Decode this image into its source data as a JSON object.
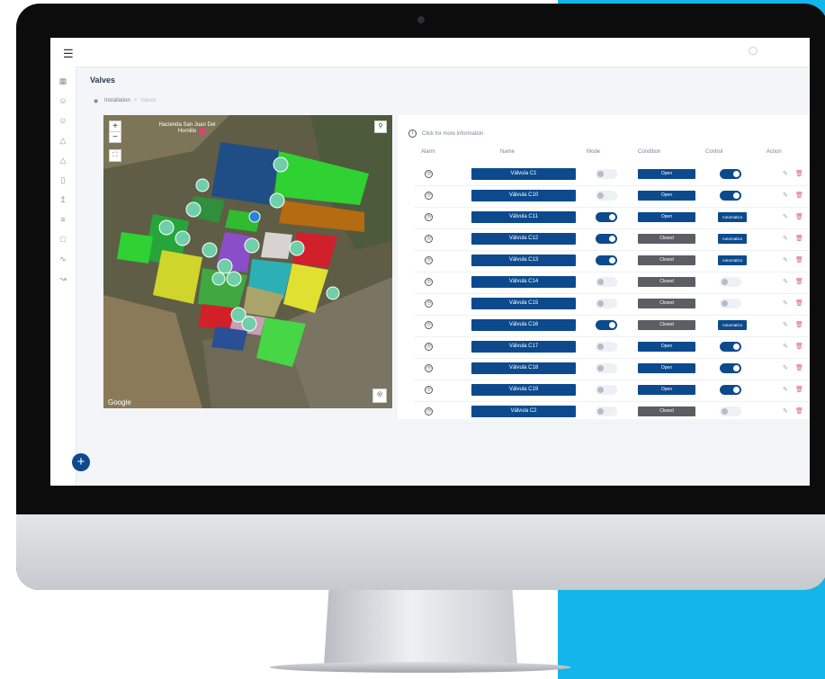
{
  "app": {
    "page_title": "Valves",
    "breadcrumb": {
      "root": "Installation",
      "separator": ">",
      "current": "Valves"
    }
  },
  "map": {
    "place_label": "Hacienda San Juan Del Hornillo",
    "zoom_in": "+",
    "zoom_out": "−",
    "attribution": "Google"
  },
  "panel": {
    "info_text": "Click for more information",
    "columns": {
      "alarm": "Alarm",
      "name": "Name",
      "mode": "Mode",
      "condition": "Condition",
      "control": "Control",
      "action": "Action"
    }
  },
  "valves": [
    {
      "name": "Válvula C1",
      "mode_on": false,
      "condition": "Open",
      "control": "on"
    },
    {
      "name": "Válvula C10",
      "mode_on": false,
      "condition": "Open",
      "control": "on"
    },
    {
      "name": "Válvula C11",
      "mode_on": true,
      "condition": "Open",
      "control": "auto"
    },
    {
      "name": "Válvula C12",
      "mode_on": true,
      "condition": "Closed",
      "control": "auto"
    },
    {
      "name": "Válvula C13",
      "mode_on": true,
      "condition": "Closed",
      "control": "auto"
    },
    {
      "name": "Válvula C14",
      "mode_on": false,
      "condition": "Closed",
      "control": "off"
    },
    {
      "name": "Válvula C15",
      "mode_on": false,
      "condition": "Closed",
      "control": "off"
    },
    {
      "name": "Válvula C16",
      "mode_on": true,
      "condition": "Closed",
      "control": "auto"
    },
    {
      "name": "Válvula C17",
      "mode_on": false,
      "condition": "Open",
      "control": "on"
    },
    {
      "name": "Válvula C18",
      "mode_on": false,
      "condition": "Open",
      "control": "on"
    },
    {
      "name": "Válvula C19",
      "mode_on": false,
      "condition": "Open",
      "control": "on"
    },
    {
      "name": "Válvula C2",
      "mode_on": false,
      "condition": "Closed",
      "control": "off"
    }
  ],
  "labels": {
    "automatic": "Automatico"
  },
  "colors": {
    "primary": "#0c4a8d",
    "closed": "#5b5e63",
    "accent_background": "#12b6ea",
    "delete": "#e05a6d"
  },
  "icons": {
    "menu": "hamburger-icon",
    "user": "user-icon",
    "fab": "plus-icon",
    "edit": "edit-icon",
    "delete": "trash-icon",
    "alarm": "clock-icon"
  }
}
